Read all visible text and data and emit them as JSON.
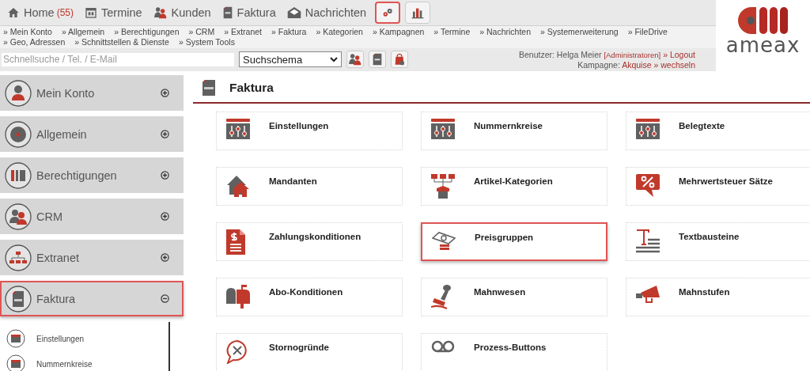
{
  "nav": {
    "items": [
      {
        "label": "Home",
        "count": "(55)"
      },
      {
        "label": "Termine"
      },
      {
        "label": "Kunden"
      },
      {
        "label": "Faktura"
      },
      {
        "label": "Nachrichten"
      }
    ],
    "tool_buttons": [
      {
        "highlighted": true
      },
      {
        "highlighted": false
      }
    ]
  },
  "links": [
    "» Mein Konto",
    "» Allgemein",
    "» Berechtigungen",
    "» CRM",
    "» Extranet",
    "» Faktura",
    "» Kategorien",
    "» Kampagnen",
    "» Termine",
    "» Nachrichten",
    "» Systemerweiterung",
    "» FileDrive",
    "» Geo, Adressen",
    "» Schnittstellen & Dienste",
    "» System Tools"
  ],
  "search": {
    "placeholder": "Schnellsuche / Tel. / E-Mail"
  },
  "scheme_select": {
    "value": "Suchschema"
  },
  "user": {
    "label": "Benutzer: Helga Meier",
    "role": "[Administratoren]",
    "logout": "» Logout",
    "campaign_label": "Kampagne:",
    "campaign": "Akquise",
    "switch": "» wechseln"
  },
  "logo": {
    "text": "ameax"
  },
  "sidebar": {
    "items": [
      {
        "label": "Mein Konto",
        "expanded": false,
        "highlighted": false
      },
      {
        "label": "Allgemein",
        "expanded": false,
        "highlighted": false
      },
      {
        "label": "Berechtigungen",
        "expanded": false,
        "highlighted": false
      },
      {
        "label": "CRM",
        "expanded": false,
        "highlighted": false
      },
      {
        "label": "Extranet",
        "expanded": false,
        "highlighted": false
      },
      {
        "label": "Faktura",
        "expanded": true,
        "highlighted": true,
        "children": [
          {
            "label": "Einstellungen"
          },
          {
            "label": "Nummernkreise"
          }
        ]
      }
    ]
  },
  "main": {
    "title": "Faktura",
    "tiles": [
      {
        "label": "Einstellungen",
        "highlighted": false
      },
      {
        "label": "Nummernkreise",
        "highlighted": false
      },
      {
        "label": "Belegtexte",
        "highlighted": false
      },
      {
        "label": "Mandanten",
        "highlighted": false
      },
      {
        "label": "Artikel-Kategorien",
        "highlighted": false
      },
      {
        "label": "Mehrwertsteuer Sätze",
        "highlighted": false
      },
      {
        "label": "Zahlungskonditionen",
        "highlighted": false
      },
      {
        "label": "Preisgruppen",
        "highlighted": true
      },
      {
        "label": "Textbausteine",
        "highlighted": false
      },
      {
        "label": "Abo-Konditionen",
        "highlighted": false
      },
      {
        "label": "Mahnwesen",
        "highlighted": false
      },
      {
        "label": "Mahnstufen",
        "highlighted": false
      },
      {
        "label": "Stornogründe",
        "highlighted": false
      },
      {
        "label": "Prozess-Buttons",
        "highlighted": false
      }
    ]
  }
}
